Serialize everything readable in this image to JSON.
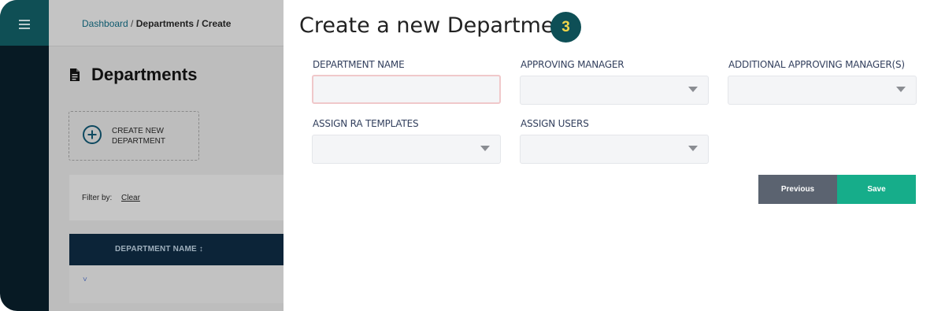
{
  "background": {
    "breadcrumb": {
      "part1": "Dashboard",
      "sep1": " / ",
      "part2": "Departments",
      "sep2": " / ",
      "part3": "Create"
    },
    "page_title": "Departments",
    "create_card": {
      "line1": "CREATE NEW",
      "line2": "DEPARTMENT"
    },
    "filter": {
      "label": "Filter by:",
      "clear": "Clear"
    },
    "table": {
      "column_header": "DEPARTMENT NAME ↕",
      "row_toggle": "˅"
    }
  },
  "panel": {
    "title": "Create a new Department",
    "step": "3",
    "fields": {
      "department_name": {
        "label": "DEPARTMENT NAME",
        "value": ""
      },
      "approving_manager": {
        "label": "APPROVING MANAGER",
        "value": ""
      },
      "additional_approving_managers": {
        "label": "ADDITIONAL APPROVING MANAGER(S)",
        "value": ""
      },
      "assign_ra_templates": {
        "label": "ASSIGN RA TEMPLATES",
        "value": ""
      },
      "assign_users": {
        "label": "ASSIGN USERS",
        "value": ""
      }
    },
    "buttons": {
      "previous": "Previous",
      "save": "Save"
    }
  },
  "colors": {
    "sidebar": "#071a24",
    "sidebar_top": "#0f4f55",
    "step_badge_bg": "#0e4f56",
    "step_badge_text": "#f0d54a",
    "previous_button": "#5b6370",
    "save_button": "#16ad8a",
    "table_header": "#0c2438"
  }
}
